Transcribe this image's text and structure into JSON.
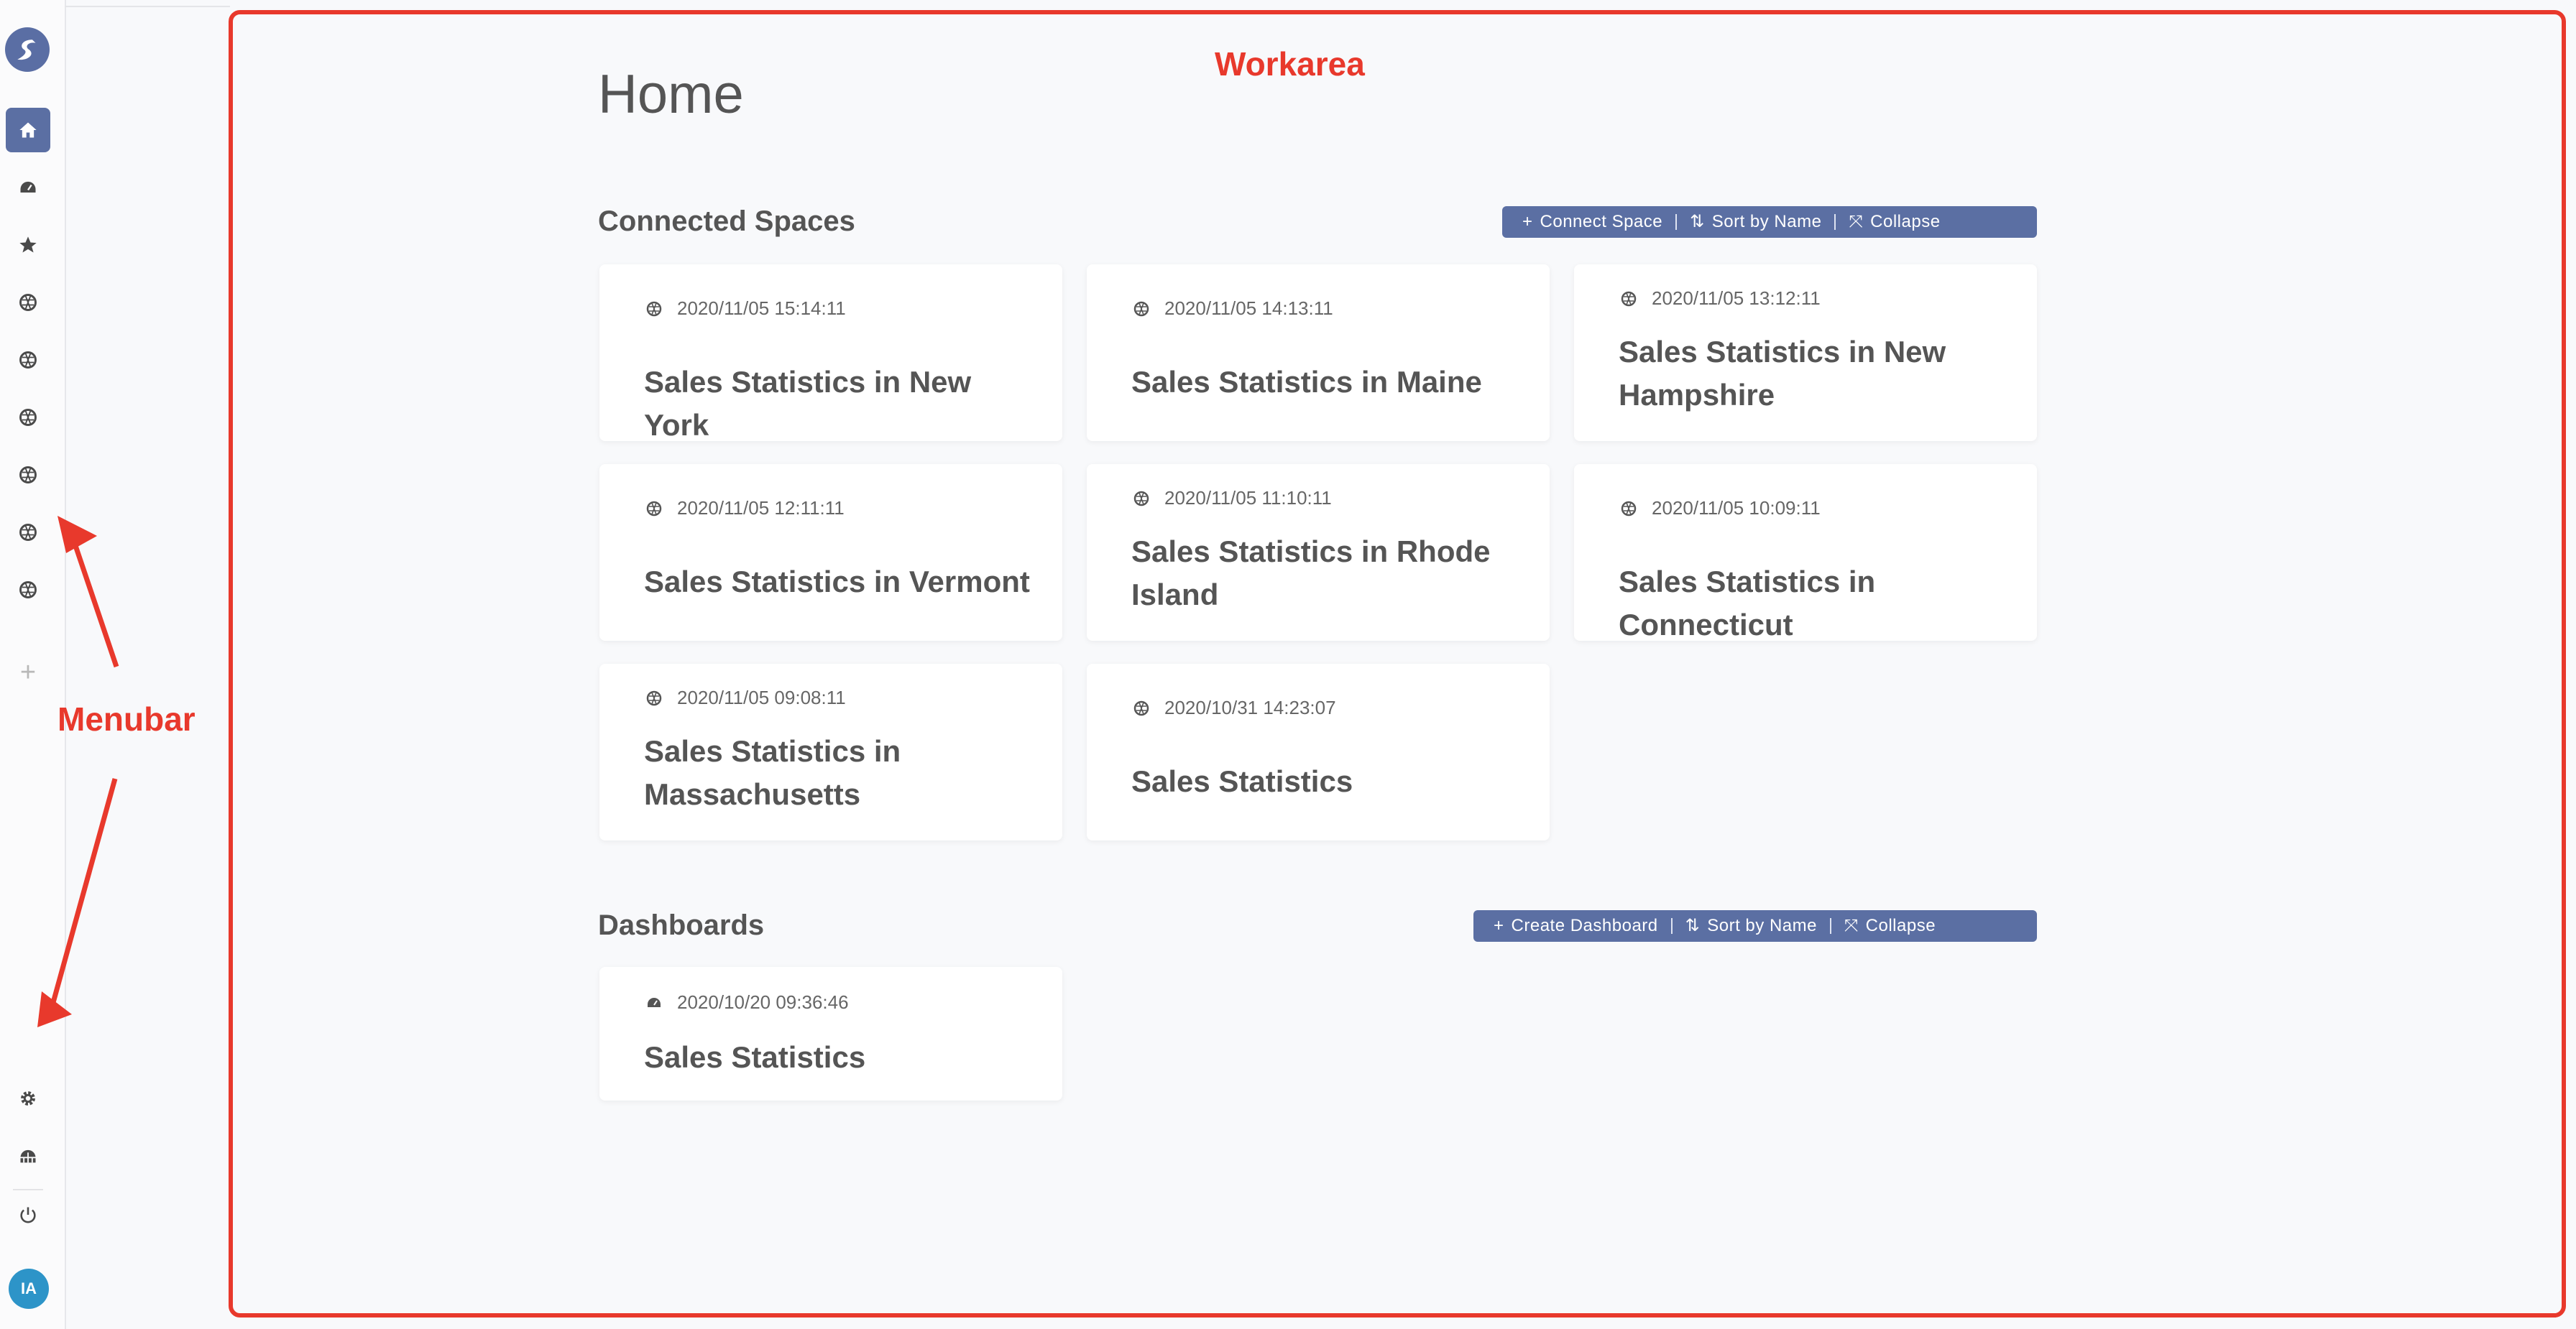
{
  "menubar": {
    "items": [
      {
        "icon": "home-icon",
        "active": true
      },
      {
        "icon": "gauge-icon"
      },
      {
        "icon": "star-icon"
      },
      {
        "icon": "space-icon"
      },
      {
        "icon": "space-icon"
      },
      {
        "icon": "space-icon"
      },
      {
        "icon": "space-icon"
      },
      {
        "icon": "space-icon"
      },
      {
        "icon": "space-icon"
      }
    ],
    "add_label": "+",
    "bottom": [
      {
        "icon": "gear-icon"
      },
      {
        "icon": "network-icon"
      },
      {
        "icon": "power-icon"
      }
    ],
    "avatar": "IA"
  },
  "annotations": {
    "workarea": "Workarea",
    "menubar": "Menubar"
  },
  "page": {
    "title": "Home"
  },
  "connected_spaces": {
    "title": "Connected Spaces",
    "actions": {
      "connect": "Connect Space",
      "sort": "Sort by Name",
      "collapse": "Collapse"
    },
    "cards": [
      {
        "date": "2020/11/05 15:14:11",
        "title": "Sales Statistics in New York"
      },
      {
        "date": "2020/11/05 14:13:11",
        "title": "Sales Statistics in Maine"
      },
      {
        "date": "2020/11/05 13:12:11",
        "title": "Sales Statistics in New Hampshire"
      },
      {
        "date": "2020/11/05 12:11:11",
        "title": "Sales Statistics in Vermont"
      },
      {
        "date": "2020/11/05 11:10:11",
        "title": "Sales Statistics in Rhode Island"
      },
      {
        "date": "2020/11/05 10:09:11",
        "title": "Sales Statistics in Connecticut"
      },
      {
        "date": "2020/11/05 09:08:11",
        "title": "Sales Statistics in Massachusetts"
      },
      {
        "date": "2020/10/31 14:23:07",
        "title": "Sales Statistics"
      }
    ]
  },
  "dashboards": {
    "title": "Dashboards",
    "actions": {
      "create": "Create Dashboard",
      "sort": "Sort by Name",
      "collapse": "Collapse"
    },
    "cards": [
      {
        "date": "2020/10/20 09:36:46",
        "title": "Sales Statistics"
      }
    ]
  }
}
